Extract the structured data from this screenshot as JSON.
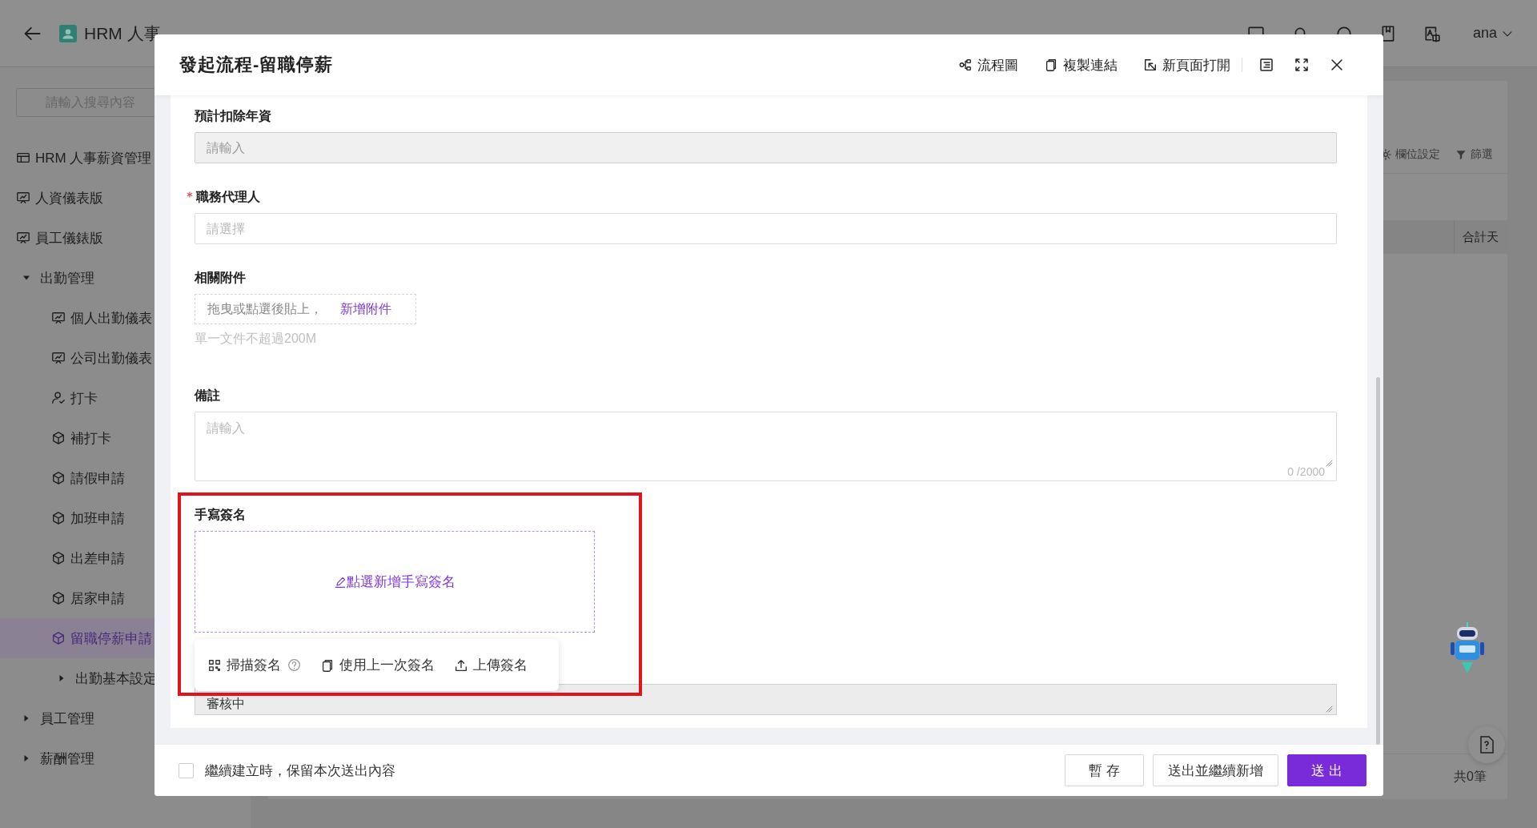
{
  "app_header": {
    "title": "HRM 人事",
    "user": "ana"
  },
  "sidebar": {
    "search_placeholder": "請輸入搜尋內容",
    "items": [
      {
        "label": "HRM 人事薪資管理",
        "selected": false
      },
      {
        "label": "人資儀表版",
        "selected": false
      },
      {
        "label": "員工儀錶版",
        "selected": false
      },
      {
        "label": "出勤管理",
        "expanded": true,
        "selected": false,
        "children": [
          {
            "label": "個人出勤儀表",
            "selected": false
          },
          {
            "label": "公司出勤儀表",
            "selected": false
          },
          {
            "label": "打卡",
            "selected": false
          },
          {
            "label": "補打卡",
            "selected": false
          },
          {
            "label": "請假申請",
            "selected": false
          },
          {
            "label": "加班申請",
            "selected": false
          },
          {
            "label": "出差申請",
            "selected": false
          },
          {
            "label": "居家申請",
            "selected": false
          },
          {
            "label": "留職停薪申請",
            "selected": true
          },
          {
            "label": "出勤基本設定",
            "expanded": false,
            "selected": false
          }
        ]
      },
      {
        "label": "員工管理",
        "expanded": false,
        "selected": false
      },
      {
        "label": "薪酬管理",
        "expanded": false,
        "selected": false
      }
    ]
  },
  "content": {
    "toolbar": [
      "欄位設定",
      "篩選"
    ],
    "column": "合計天",
    "total": "共0筆"
  },
  "modal": {
    "title": "發起流程-留職停薪",
    "actions": [
      "流程圖",
      "複製連結",
      "新頁面打開"
    ],
    "fields": [
      {
        "kind": "input",
        "label": "預計扣除年資",
        "placeholder": "請輸入",
        "disabled": true,
        "required": false
      },
      {
        "kind": "input",
        "label": "職務代理人",
        "placeholder": "請選擇",
        "disabled": false,
        "required": true
      },
      {
        "kind": "upload",
        "label": "相關附件",
        "prompt": "拖曳或點選後貼上，",
        "link": "新增附件",
        "hint": "單一文件不超過200M"
      },
      {
        "kind": "textarea",
        "label": "備註",
        "placeholder": "請輸入",
        "counter": "0 /2000"
      },
      {
        "kind": "signature",
        "label": "手寫簽名",
        "prompt": "點選新增手寫簽名",
        "highlighted": true,
        "options": [
          {
            "label": "掃描簽名",
            "help": true
          },
          {
            "label": "使用上一次簽名",
            "help": false
          },
          {
            "label": "上傳簽名",
            "help": false
          }
        ]
      },
      {
        "kind": "status",
        "value": "審核中",
        "disabled": true
      }
    ],
    "footer": {
      "keep_content": {
        "label": "繼續建立時，保留本次送出內容",
        "checked": false
      },
      "buttons": [
        {
          "label": "暫 存",
          "kind": "default"
        },
        {
          "label": "送出並繼續新增",
          "kind": "default"
        },
        {
          "label": "送 出",
          "kind": "primary"
        }
      ]
    }
  }
}
